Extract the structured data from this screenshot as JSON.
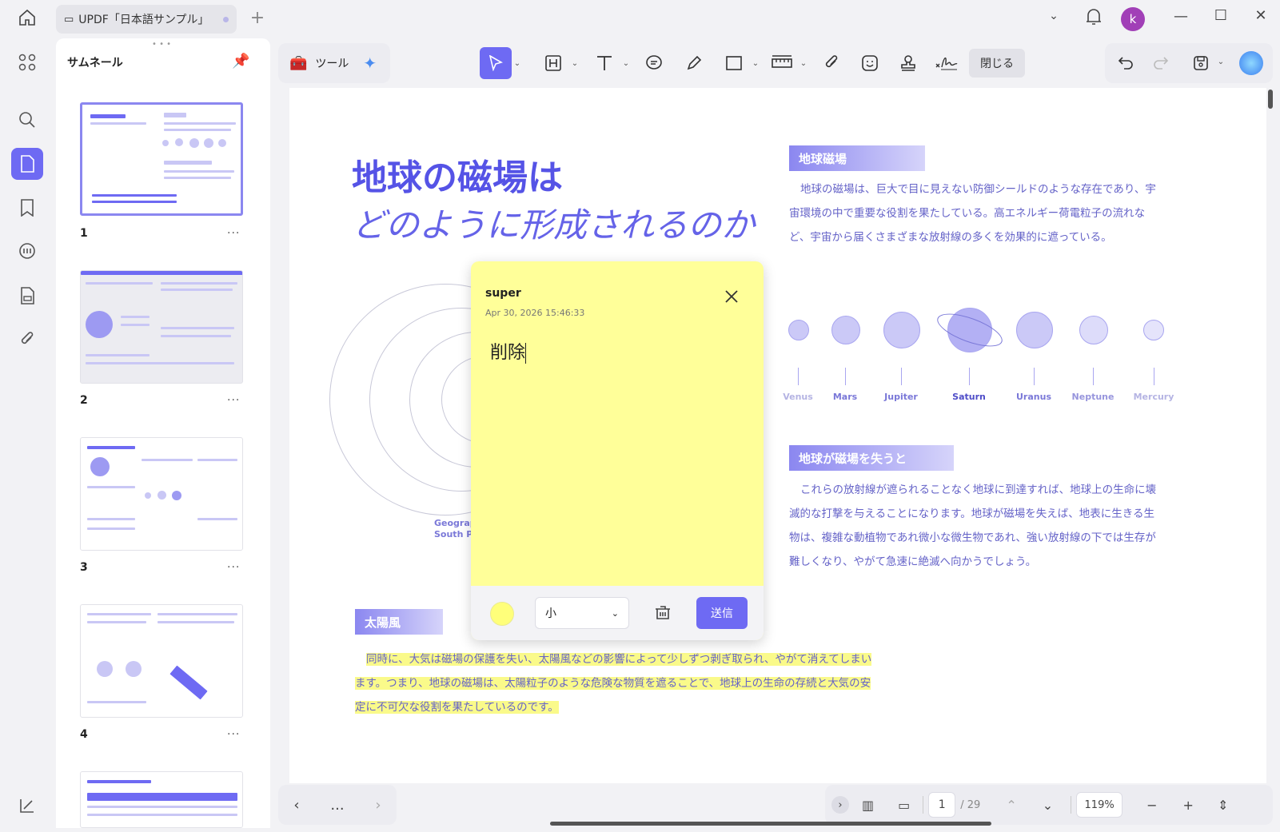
{
  "window": {
    "tab_title": "UPDF「日本語サンプル」",
    "user_initial": "k"
  },
  "sidebar": {
    "panel_title": "サムネール",
    "thumbnails": [
      {
        "page": "1"
      },
      {
        "page": "2"
      },
      {
        "page": "3"
      },
      {
        "page": "4"
      }
    ]
  },
  "toolbar": {
    "tools_label": "ツール",
    "close_label": "閉じる"
  },
  "document": {
    "title_line1": "地球の磁場は",
    "title_line2": "どのように形成されるのか",
    "section1_title": "地球磁場",
    "section1_body": "地球の磁場は、巨大で目に見えない防御シールドのような存在であり、宇宙環境の中で重要な役割を果たしている。高エネルギー荷電粒子の流れなど、宇宙から届くさまざまな放射線の多くを効果的に遮っている。",
    "planets": [
      "Venus",
      "Mars",
      "Jupiter",
      "Saturn",
      "Uranus",
      "Neptune",
      "Mercury"
    ],
    "section2_title": "地球が磁場を失うと",
    "section2_body": "これらの放射線が遮られることなく地球に到達すれば、地球上の生命に壊滅的な打撃を与えることになります。地球が磁場を失えば、地表に生きる生物は、複雑な動植物であれ微小な微生物であれ、強い放射線の下では生存が難しくなり、やがて急速に絶滅へ向かうでしょう。",
    "diagram_label1": "Geograp",
    "diagram_label2": "South Po",
    "section3_title": "太陽風",
    "section3_body": "同時に、大気は磁場の保護を失い、太陽風などの影響によって少しずつ剥ぎ取られ、やがて消えてしまいます。つまり、地球の磁場は、太陽粒子のような危険な物質を遮ることで、地球上の生命の存続と大気の安定に不可欠な役割を果たしているのです。"
  },
  "note": {
    "author": "super",
    "timestamp": "Apr 30, 2026 15:46:33",
    "text": "削除",
    "size_value": "小",
    "send_label": "送信",
    "color": "#ffff7a"
  },
  "navigation": {
    "current_page": "1",
    "total_pages": "/ 29",
    "zoom": "119%",
    "more": "..."
  },
  "colors": {
    "accent": "#6e6af3",
    "note_bg": "#ffff99",
    "highlight": "#fafa8a"
  }
}
